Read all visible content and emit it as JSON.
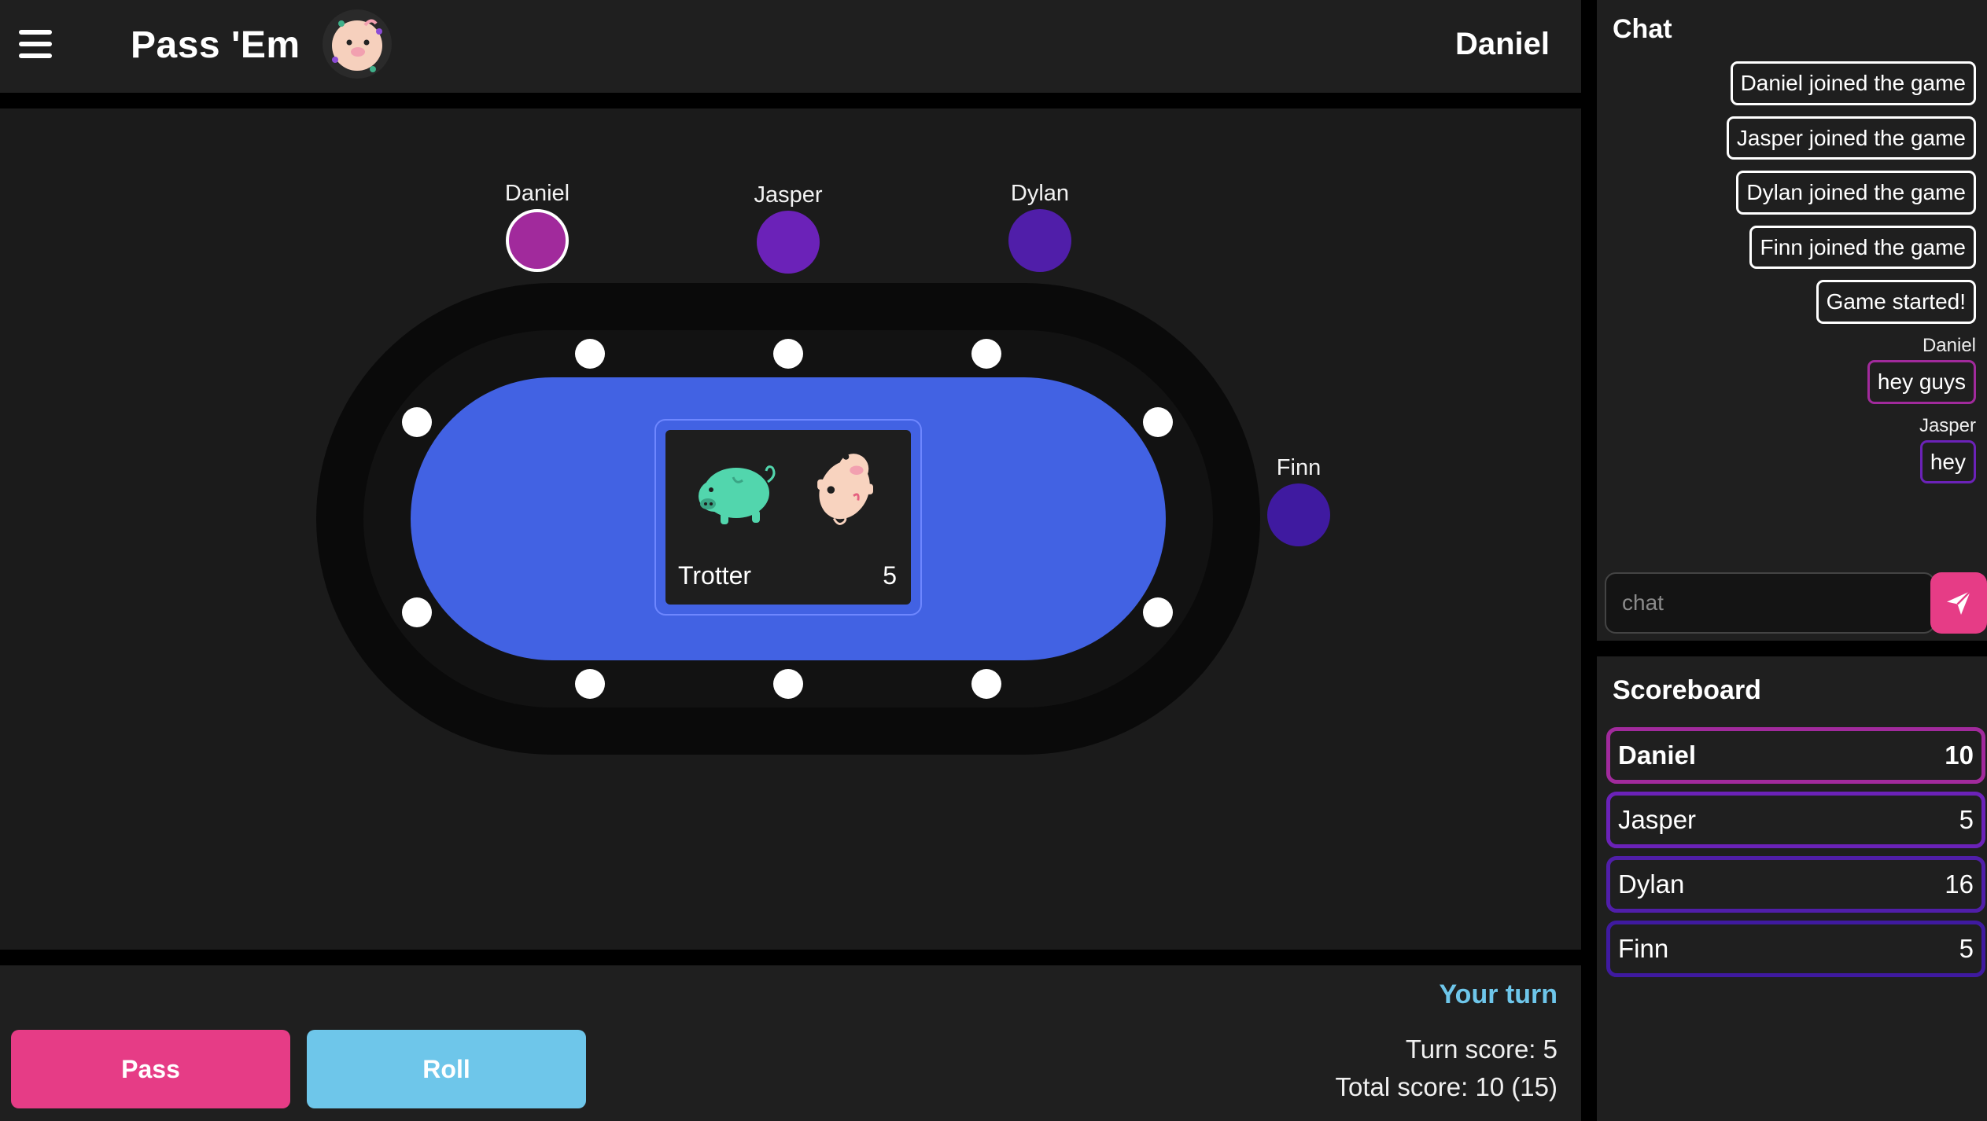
{
  "header": {
    "title": "Pass 'Em",
    "user_name": "Daniel",
    "menu_icon": "hamburger-menu-icon",
    "logo_icon": "pig-logo-icon"
  },
  "table": {
    "seats": [
      {
        "name": "Daniel",
        "color": "#a12a9c",
        "active": true
      },
      {
        "name": "Jasper",
        "color": "#6b22b8"
      },
      {
        "name": "Dylan",
        "color": "#501ea9"
      },
      {
        "name": "Finn",
        "color": "#3f1aa0"
      }
    ],
    "current_roll": {
      "name": "Trotter",
      "score": "5",
      "pig_icons": [
        "green-pig-icon",
        "pink-pig-icon"
      ]
    },
    "felt_color": "#4262e3"
  },
  "actions": {
    "pass_label": "Pass",
    "roll_label": "Roll",
    "turn_indicator": "Your turn",
    "turn_score": "Turn score: 5",
    "total_score": "Total score: 10 (15)"
  },
  "chat": {
    "title": "Chat",
    "messages": [
      {
        "sender": "",
        "text": "Daniel joined the game",
        "color": "#ffffff"
      },
      {
        "sender": "",
        "text": "Jasper joined the game",
        "color": "#ffffff"
      },
      {
        "sender": "",
        "text": "Dylan joined the game",
        "color": "#ffffff"
      },
      {
        "sender": "",
        "text": "Finn joined the game",
        "color": "#ffffff"
      },
      {
        "sender": "",
        "text": "Game started!",
        "color": "#ffffff"
      },
      {
        "sender": "Daniel",
        "text": "hey guys",
        "color": "#a12a9c"
      },
      {
        "sender": "Jasper",
        "text": "hey",
        "color": "#6b22b8"
      }
    ],
    "input_placeholder": "chat",
    "send_icon": "paper-plane-send-icon"
  },
  "scoreboard": {
    "title": "Scoreboard",
    "rows": [
      {
        "name": "Daniel",
        "score": "10",
        "color": "#a12a9c",
        "bold": true
      },
      {
        "name": "Jasper",
        "score": "5",
        "color": "#6b22b8"
      },
      {
        "name": "Dylan",
        "score": "16",
        "color": "#501ea9"
      },
      {
        "name": "Finn",
        "score": "5",
        "color": "#3f1aa0"
      }
    ]
  },
  "colors": {
    "accent_pink": "#e63c86",
    "accent_blue": "#6ec6ea",
    "panel_bg": "#1f1f1f"
  }
}
